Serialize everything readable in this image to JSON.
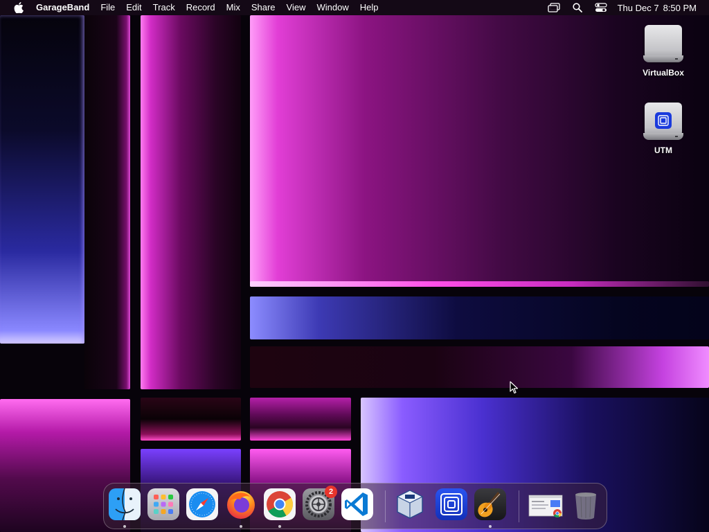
{
  "menubar": {
    "apple_icon": "apple-icon",
    "app_name": "GarageBand",
    "items": [
      "File",
      "Edit",
      "Track",
      "Record",
      "Mix",
      "Share",
      "View",
      "Window",
      "Help"
    ],
    "status_icons": [
      "screen-mirroring-icon",
      "search-icon",
      "control-center-icon"
    ],
    "date": "Thu Dec 7",
    "time": "8:50 PM"
  },
  "desktop_icons": [
    {
      "label": "VirtualBox",
      "icon": "external-drive-icon"
    },
    {
      "label": "UTM",
      "icon": "utm-drive-icon"
    }
  ],
  "dock": {
    "apps": [
      {
        "name": "Finder",
        "icon": "finder-icon",
        "running": true
      },
      {
        "name": "Launchpad",
        "icon": "launchpad-icon",
        "running": false
      },
      {
        "name": "Safari",
        "icon": "safari-icon",
        "running": false
      },
      {
        "name": "Firefox",
        "icon": "firefox-icon",
        "running": true
      },
      {
        "name": "Google Chrome",
        "icon": "chrome-icon",
        "running": true
      },
      {
        "name": "System Settings",
        "icon": "system-settings-icon",
        "running": false,
        "badge": "2"
      },
      {
        "name": "Visual Studio Code",
        "icon": "vscode-icon",
        "running": false
      },
      {
        "name": "VirtualBox",
        "icon": "virtualbox-icon",
        "running": false
      },
      {
        "name": "UTM",
        "icon": "utm-icon",
        "running": false
      },
      {
        "name": "GarageBand",
        "icon": "garageband-icon",
        "running": true
      },
      {
        "name": "Chrome window",
        "icon": "minimized-window-icon",
        "running": false
      },
      {
        "name": "Trash",
        "icon": "trash-icon",
        "running": false
      }
    ]
  },
  "colors": {
    "menubar_bg": "#160a18",
    "accent_pink": "#ff4fe8",
    "accent_blue": "#4a30d0",
    "badge_red": "#e8352c"
  }
}
